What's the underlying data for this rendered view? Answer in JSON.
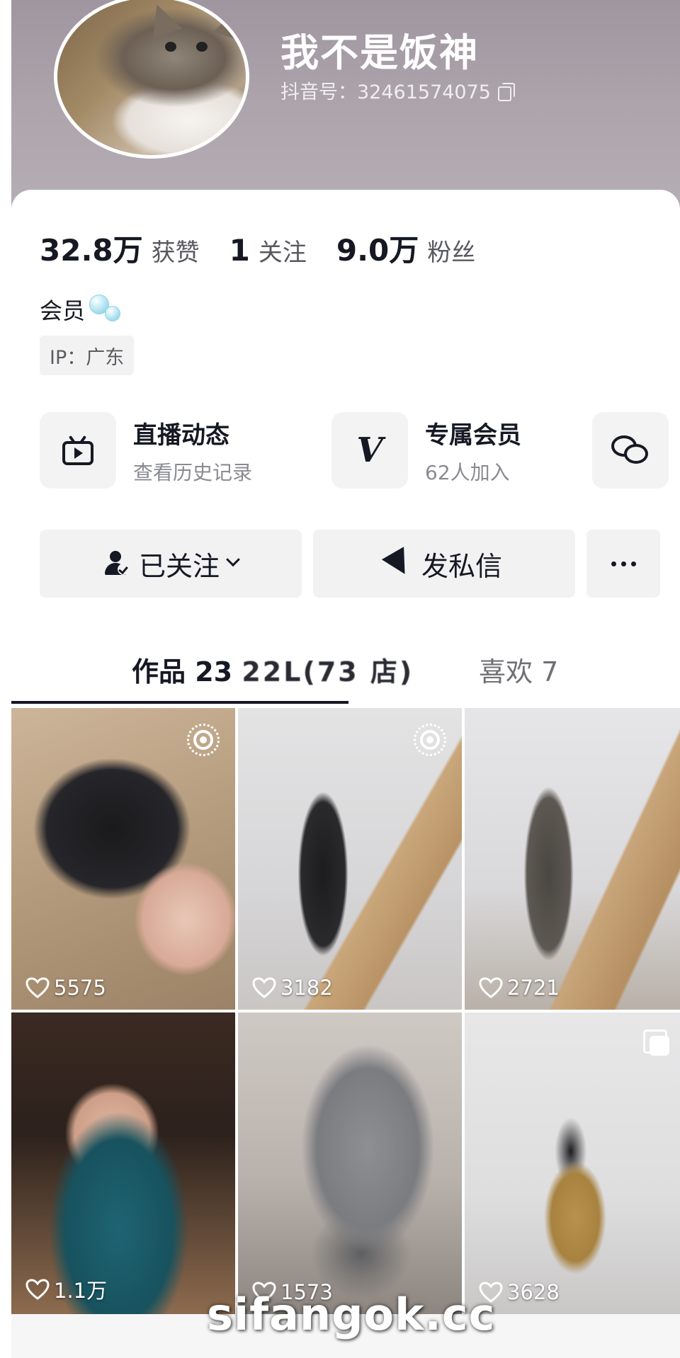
{
  "profile": {
    "nickname": "我不是饭神",
    "douyin_id": "抖音号：32461574075"
  },
  "stats": [
    {
      "value": "32.8万",
      "label": "获赞"
    },
    {
      "value": "1",
      "label": "关注"
    },
    {
      "value": "9.0万",
      "label": "粉丝"
    }
  ],
  "member_label": "会员",
  "ip_label": "IP：广东",
  "services": {
    "live": {
      "title": "直播动态",
      "subtitle": "查看历史记录"
    },
    "exclusive": {
      "title": "专属会员",
      "subtitle": "62人加入"
    }
  },
  "actions": {
    "follow_label": "已关注",
    "message_label": "发私信"
  },
  "tabs": {
    "works_label": "作品 23",
    "works_obscured": "22L(73 店)",
    "likes_label": "喜欢 7"
  },
  "posts": [
    {
      "likes": "5575",
      "badge": "live"
    },
    {
      "likes": "3182",
      "badge": "live"
    },
    {
      "likes": "2721",
      "badge": ""
    },
    {
      "likes": "1.1万",
      "badge": ""
    },
    {
      "likes": "1573",
      "badge": ""
    },
    {
      "likes": "3628",
      "badge": "multi"
    }
  ],
  "watermark": "sifangok.cc",
  "colors": {
    "header_bg": "#a9a0a8",
    "text_primary": "#161823",
    "text_secondary": "#8a8b91",
    "button_bg": "#f2f2f3"
  }
}
